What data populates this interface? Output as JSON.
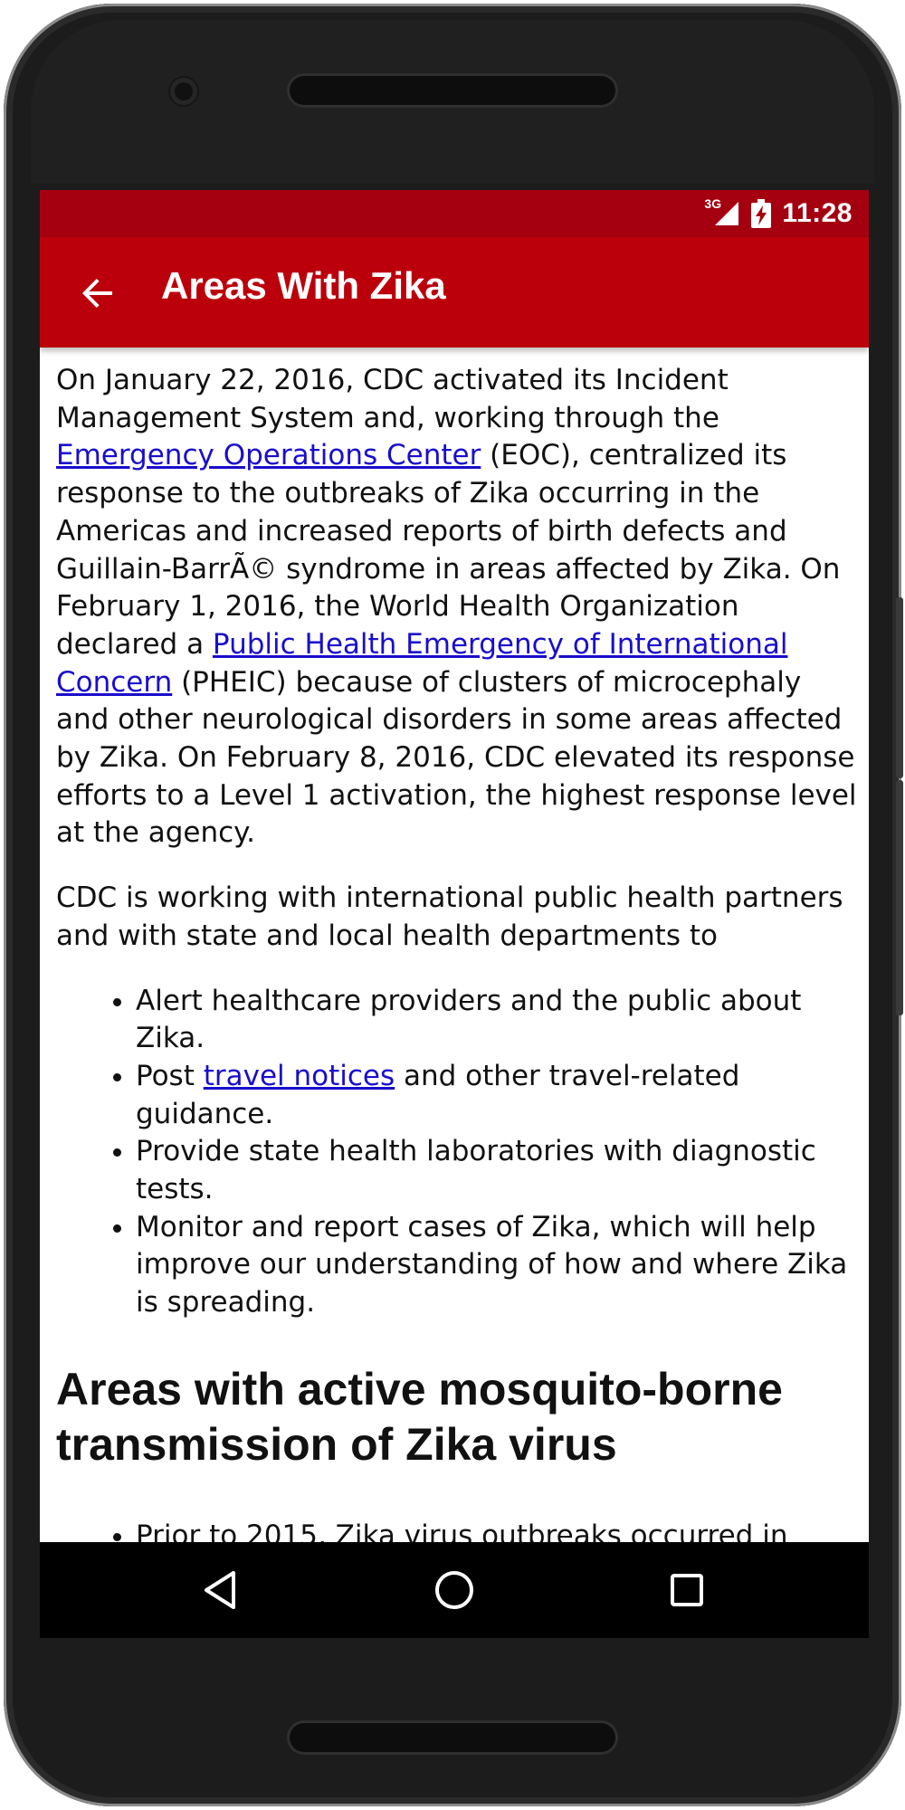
{
  "status_bar": {
    "network": "3G",
    "time": "11:28"
  },
  "app_bar": {
    "title": "Areas With Zika",
    "back_icon": "arrow-left-icon"
  },
  "article": {
    "p1": {
      "t1": "On January 22, 2016, CDC activated its Incident Management System and, working through the ",
      "link1": "Emergency Operations Center",
      "t2": " (EOC), centralized its response to the outbreaks of Zika occurring in the Americas and increased reports of birth defects and Guillain-BarrÃ© syndrome in areas affected by Zika. On February 1, 2016, the World Health Organization declared a ",
      "link2": "Public Health Emergency of International Concern",
      "t3": " (PHEIC) because of clusters of microcephaly and other neurological disorders in some areas affected by Zika. On February 8, 2016, CDC elevated its response efforts to a Level 1 activation, the highest response level at the agency."
    },
    "p2": "CDC is working with international public health partners and with state and local health departments to",
    "list": {
      "item1": "Alert healthcare providers and the public about Zika.",
      "item2_pre": "Post ",
      "item2_link": "travel notices",
      "item2_post": " and other travel-related guidance.",
      "item3": "Provide state health laboratories with diagnostic tests.",
      "item4": "Monitor and report cases of Zika, which will help improve our understanding of how and where Zika is spreading."
    },
    "heading": "Areas with active mosquito-borne transmission of Zika virus",
    "list2_item1": "Prior to 2015, Zika virus outbreaks occurred in"
  },
  "colors": {
    "status_bar": "#a50010",
    "app_bar": "#bb000c",
    "link": "#1a0dcc"
  },
  "nav_bar": {
    "back": "triangle-back-icon",
    "home": "circle-home-icon",
    "recents": "square-recents-icon"
  }
}
